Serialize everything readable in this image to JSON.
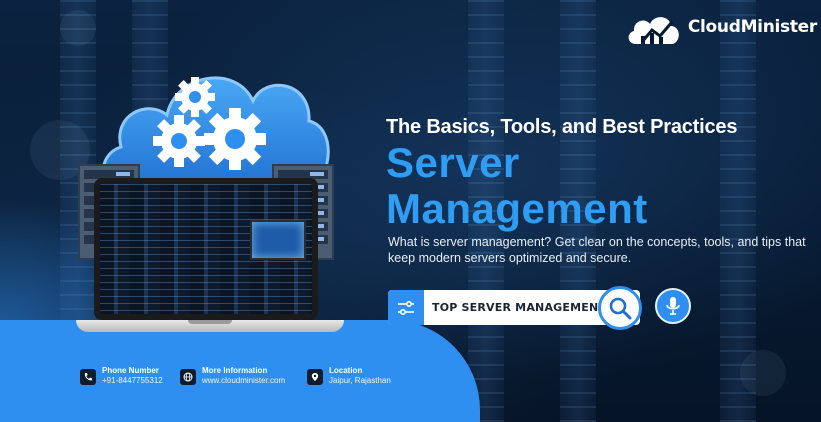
{
  "brand": {
    "name": "CloudMinister",
    "logo_icon": "cloud-chart-icon"
  },
  "hero": {
    "subheading": "The Basics, Tools, and Best Practices",
    "title_line1": "Server",
    "title_line2": "Management",
    "description": "What is server management? Get clear on the concepts, tools, and tips that keep modern servers optimized and secure.",
    "illustration": {
      "cloud_icon": "cloud-gears-icon",
      "device": "laptop-icon",
      "side_units": "server-rack-icon"
    }
  },
  "search": {
    "query": "TOP SERVER MANAGEMENT",
    "filter_icon": "filter-sliders-icon",
    "search_icon": "magnifier-icon",
    "mic_icon": "microphone-icon"
  },
  "contacts": [
    {
      "label": "Phone Number",
      "value": "+91-8447755312",
      "icon": "phone-icon"
    },
    {
      "label": "More Information",
      "value": "www.cloudminister.com",
      "icon": "globe-icon"
    },
    {
      "label": "Location",
      "value": "Jaipur, Rajasthan",
      "icon": "location-pin-icon"
    }
  ],
  "colors": {
    "background": "#07182d",
    "accent": "#2f9df4",
    "panel": "#2f8ff0",
    "text": "#ffffff"
  }
}
